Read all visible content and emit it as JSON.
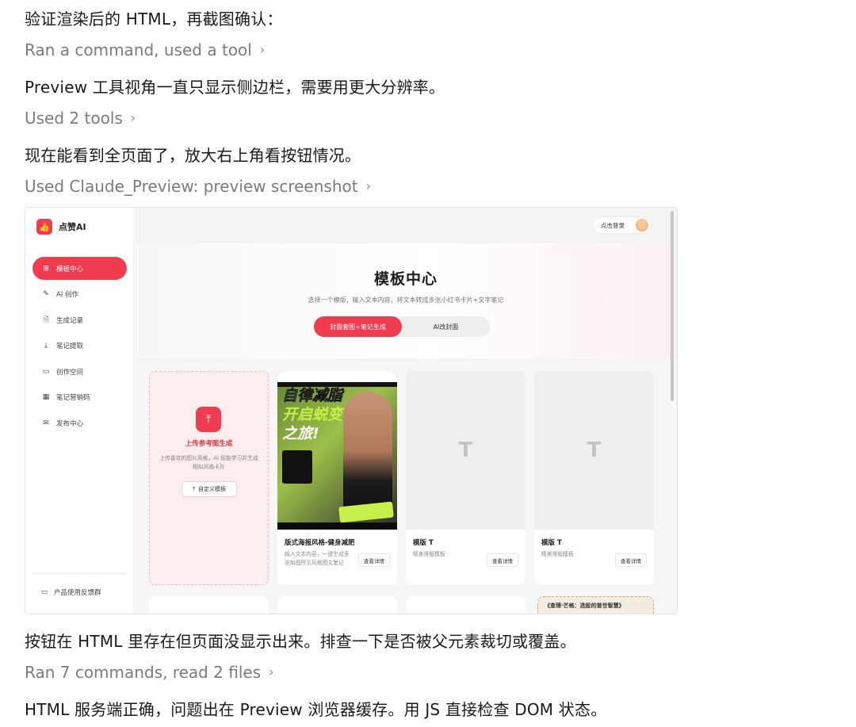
{
  "chat": {
    "msg1": "验证渲染后的 HTML，再截图确认：",
    "tool1": "Ran a command, used a tool",
    "msg2": "Preview 工具视角一直只显示侧边栏，需要用更大分辨率。",
    "tool2": "Used 2 tools",
    "msg3": "现在能看到全页面了，放大右上角看按钮情况。",
    "tool3": "Used Claude_Preview: preview screenshot",
    "msg4": "按钮在 HTML 里存在但页面没显示出来。排查一下是否被父元素裁切或覆盖。",
    "tool4": "Ran 7 commands, read 2 files",
    "msg5": "HTML 服务端正确，问题出在 Preview 浏览器缓存。用 JS 直接检查 DOM 状态。",
    "chevron": "›"
  },
  "preview": {
    "brand": "点赞AI",
    "nav": [
      {
        "label": "模板中心",
        "icon": "grid-icon",
        "glyph": "⊞"
      },
      {
        "label": "AI 创作",
        "icon": "edit-icon",
        "glyph": "✎"
      },
      {
        "label": "生成记录",
        "icon": "file-icon",
        "glyph": "🗎"
      },
      {
        "label": "笔记提取",
        "icon": "download-icon",
        "glyph": "⤓"
      },
      {
        "label": "创作空间",
        "icon": "folder-icon",
        "glyph": "▭"
      },
      {
        "label": "笔记营销码",
        "icon": "qr-icon",
        "glyph": "▦"
      },
      {
        "label": "发布中心",
        "icon": "mail-icon",
        "glyph": "✉"
      }
    ],
    "feedback": "产品使用反馈群",
    "login": "点击登录",
    "title": "模板中心",
    "subtitle": "选择一个模版，输入文本内容，将文本转成多张小红书卡片+文字笔记",
    "seg_active": "封面套图+笔记生成",
    "seg_other": "AI改封面",
    "upload": {
      "title": "上传参考图生成",
      "desc": "上传喜欢的图片风格，AI 智能学习并生成相似风格卡片",
      "button": "自定义模板"
    },
    "cards": [
      {
        "name": "版式海报风格-健身减肥",
        "desc": "输入文本内容，一键生成多张如图所示风格图文笔记",
        "button": "查看详情"
      },
      {
        "name": "模版 T",
        "desc": "精美排版模板",
        "button": "查看详情",
        "thumb": "T"
      },
      {
        "name": "模版 T",
        "desc": "精美排版模板",
        "button": "查看详情",
        "thumb": "T"
      }
    ],
    "poster": {
      "line1": "自律减脂",
      "line2": "开启蜕变",
      "line3": "之旅!"
    },
    "peek": "《查理·芒格：选股的普世智慧》"
  }
}
